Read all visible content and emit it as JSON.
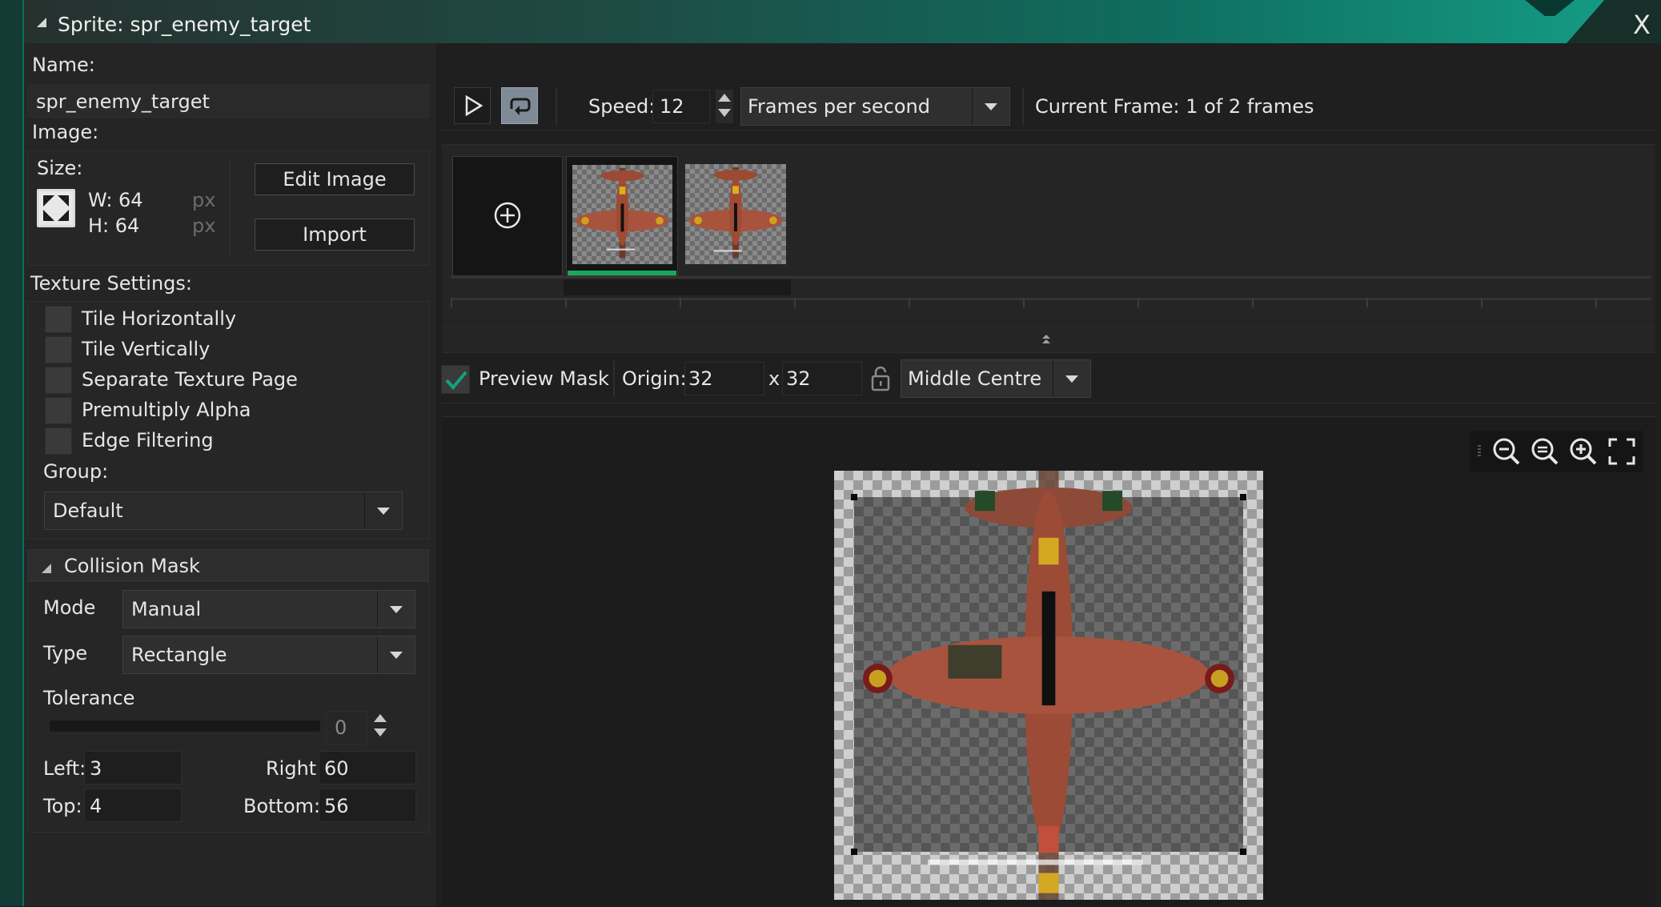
{
  "window": {
    "title": "Sprite: spr_enemy_target",
    "close_label": "X"
  },
  "left": {
    "name_label": "Name:",
    "name_value": "spr_enemy_target",
    "image_label": "Image:",
    "size_label": "Size:",
    "width": "W: 64",
    "height": "H: 64",
    "px_unit": "px",
    "edit_image_label": "Edit Image",
    "import_label": "Import",
    "texture_settings_label": "Texture Settings:",
    "texture_options": [
      {
        "label": "Tile Horizontally",
        "checked": false
      },
      {
        "label": "Tile Vertically",
        "checked": false
      },
      {
        "label": "Separate Texture Page",
        "checked": false
      },
      {
        "label": "Premultiply Alpha",
        "checked": false
      },
      {
        "label": "Edge Filtering",
        "checked": false
      }
    ],
    "group_label": "Group:",
    "group_value": "Default",
    "collision": {
      "header": "Collision Mask",
      "mode_label": "Mode",
      "mode_value": "Manual",
      "type_label": "Type",
      "type_value": "Rectangle",
      "tolerance_label": "Tolerance",
      "tolerance_value": "0",
      "left_label": "Left:",
      "left_value": "3",
      "right_label": "Right:",
      "right_value": "60",
      "top_label": "Top:",
      "top_value": "4",
      "bottom_label": "Bottom:",
      "bottom_value": "56"
    }
  },
  "playback": {
    "speed_label": "Speed:",
    "speed_value": "12",
    "speed_unit": "Frames per second",
    "current_frame": "Current Frame: 1 of 2 frames"
  },
  "frames": {
    "count": 2,
    "selected_index": 0
  },
  "origin_bar": {
    "preview_mask_label": "Preview Mask",
    "preview_mask_checked": true,
    "origin_label": "Origin:",
    "origin_x": "32",
    "origin_sep": "x",
    "origin_y": "32",
    "origin_preset": "Middle Centre"
  },
  "colors": {
    "accent": "#0f9a7e",
    "title_gradient_end": "#14a088",
    "selected_frame_bar": "#19a85a",
    "plane_body": "#a8533d"
  }
}
